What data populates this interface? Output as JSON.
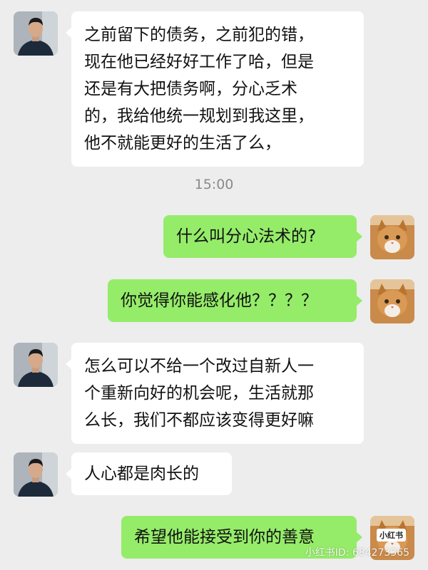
{
  "messages": [
    {
      "side": "in",
      "lines": [
        "之前留下的债务，之前犯的错，",
        "现在他已经好好工作了哈，但是",
        "还是有大把债务啊，分心乏术",
        "的，我给他统一规划到我这里，",
        "他不就能更好的生活了么，"
      ]
    },
    {
      "side": "out",
      "lines": [
        "什么叫分心法术的?"
      ]
    },
    {
      "side": "out",
      "lines": [
        "你觉得你能感化他？？？？"
      ]
    },
    {
      "side": "in",
      "lines": [
        "怎么可以不给一个改过自新人一",
        "个重新向好的机会呢，生活就那",
        "么长，我们不都应该变得更好嘛"
      ]
    },
    {
      "side": "in",
      "lines": [
        "人心都是肉长的"
      ]
    },
    {
      "side": "out",
      "lines": [
        "希望他能接受到你的善意"
      ]
    }
  ],
  "timestamp": "15:00",
  "watermark": {
    "logo_text": "小红书",
    "text": "小红书ID: 684273365"
  },
  "colors": {
    "background": "#ededed",
    "incoming_bubble": "#ffffff",
    "outgoing_bubble": "#95ec69"
  },
  "avatars": {
    "incoming": "man-portrait-avatar",
    "outgoing": "cat-avatar"
  }
}
